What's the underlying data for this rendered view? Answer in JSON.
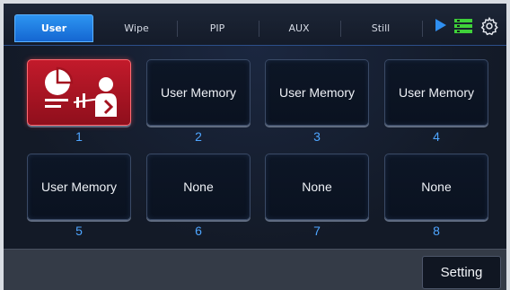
{
  "tabs": [
    {
      "label": "User",
      "active": true
    },
    {
      "label": "Wipe",
      "active": false
    },
    {
      "label": "PIP",
      "active": false
    },
    {
      "label": "AUX",
      "active": false
    },
    {
      "label": "Still",
      "active": false
    }
  ],
  "toolbar_icons": [
    "play-icon",
    "multiview-icon",
    "settings-gear-icon"
  ],
  "memories": [
    {
      "number": "1",
      "label": "",
      "selected": true,
      "icon": "presenter-pie-chart-icon"
    },
    {
      "number": "2",
      "label": "User Memory",
      "selected": false
    },
    {
      "number": "3",
      "label": "User Memory",
      "selected": false
    },
    {
      "number": "4",
      "label": "User Memory",
      "selected": false
    },
    {
      "number": "5",
      "label": "User Memory",
      "selected": false
    },
    {
      "number": "6",
      "label": "None",
      "selected": false
    },
    {
      "number": "7",
      "label": "None",
      "selected": false
    },
    {
      "number": "8",
      "label": "None",
      "selected": false
    }
  ],
  "bottom": {
    "setting_label": "Setting"
  },
  "colors": {
    "accent_blue": "#1f7ee8",
    "selected_red": "#b3182a",
    "number_blue": "#4ea5ff",
    "multiview_green": "#3fd13a"
  }
}
